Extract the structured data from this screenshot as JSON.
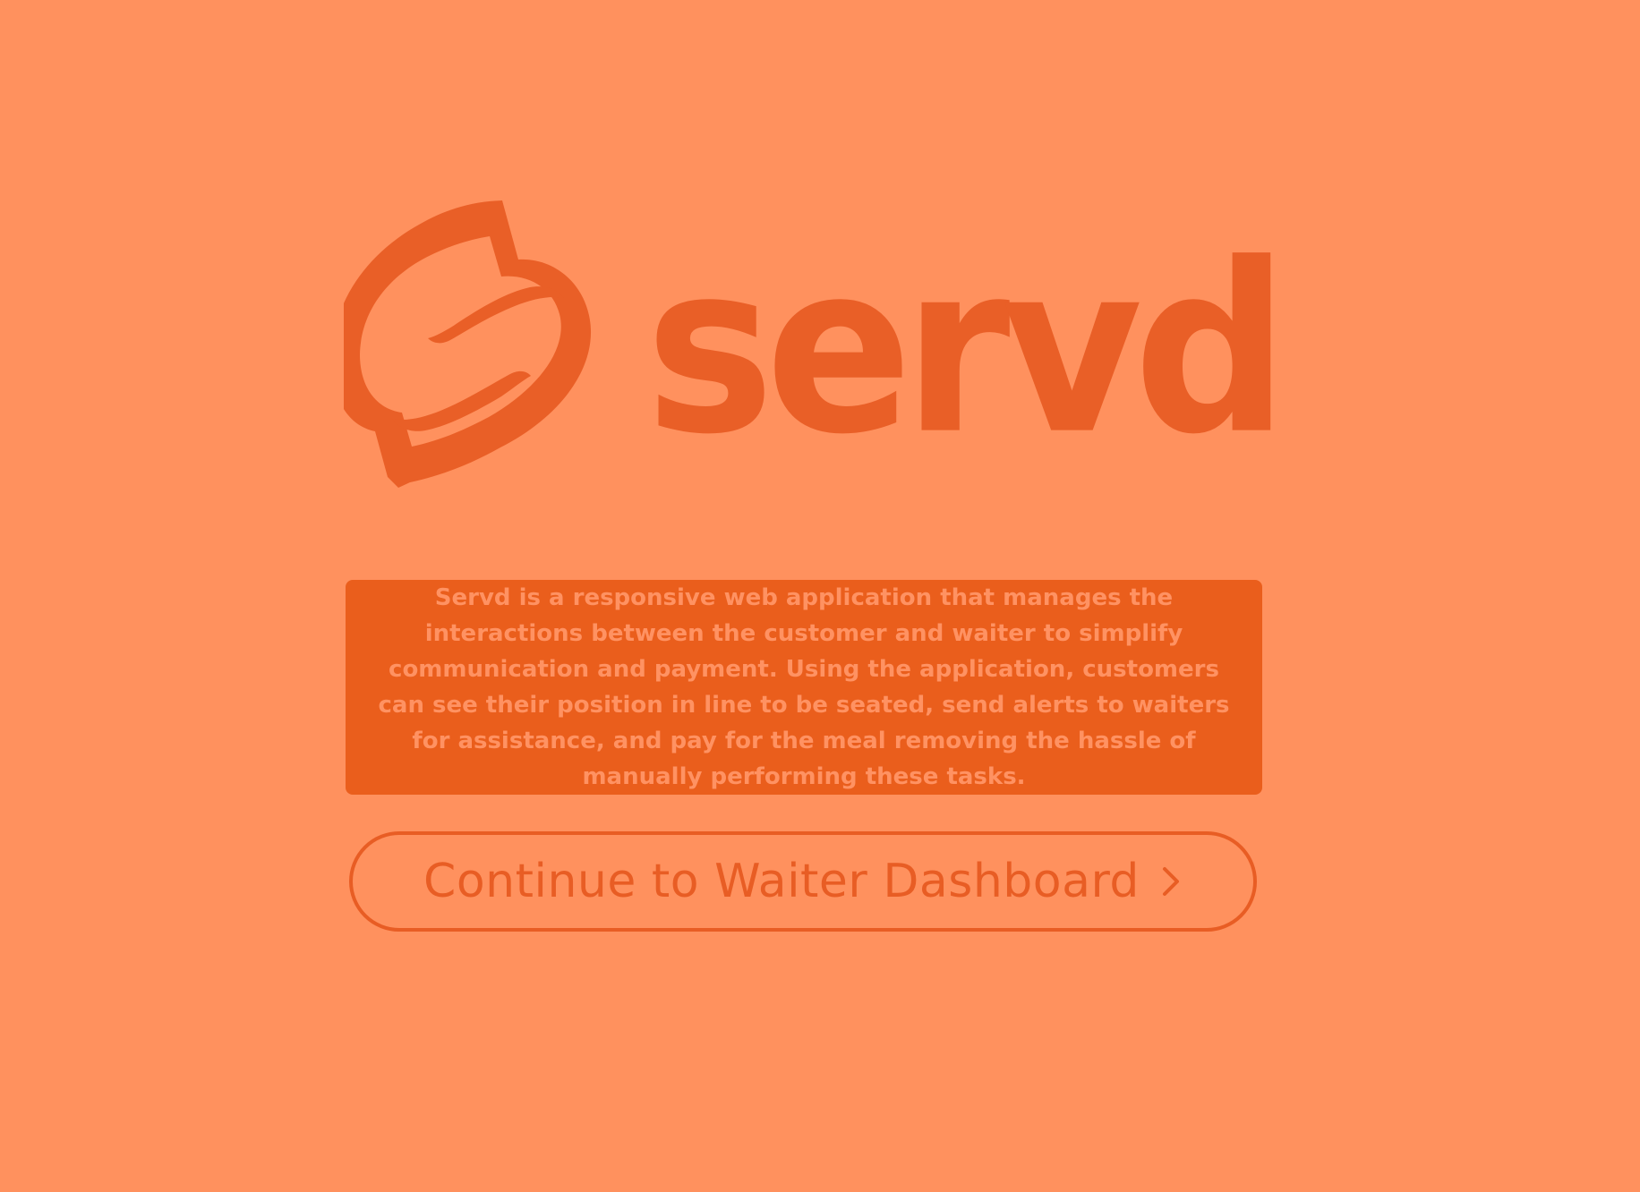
{
  "app": {
    "brand_name": "servd",
    "colors": {
      "background": "#ff915e",
      "accent": "#e95f27",
      "panel": "#ea5e1c",
      "panel_text": "#ff9262"
    }
  },
  "hero": {
    "logo_mark_icon": "s-logo-icon",
    "logo_text": "servd"
  },
  "description": {
    "text": "Servd is a responsive web application that manages the interactions between the customer and waiter to simplify communication and payment. Using the application, customers can see their position in line to be seated, send alerts to waiters for assistance, and pay for the meal removing the hassle of manually performing these tasks."
  },
  "actions": {
    "continue_label": "Continue to Waiter Dashboard",
    "continue_icon": "chevron-right-icon"
  }
}
